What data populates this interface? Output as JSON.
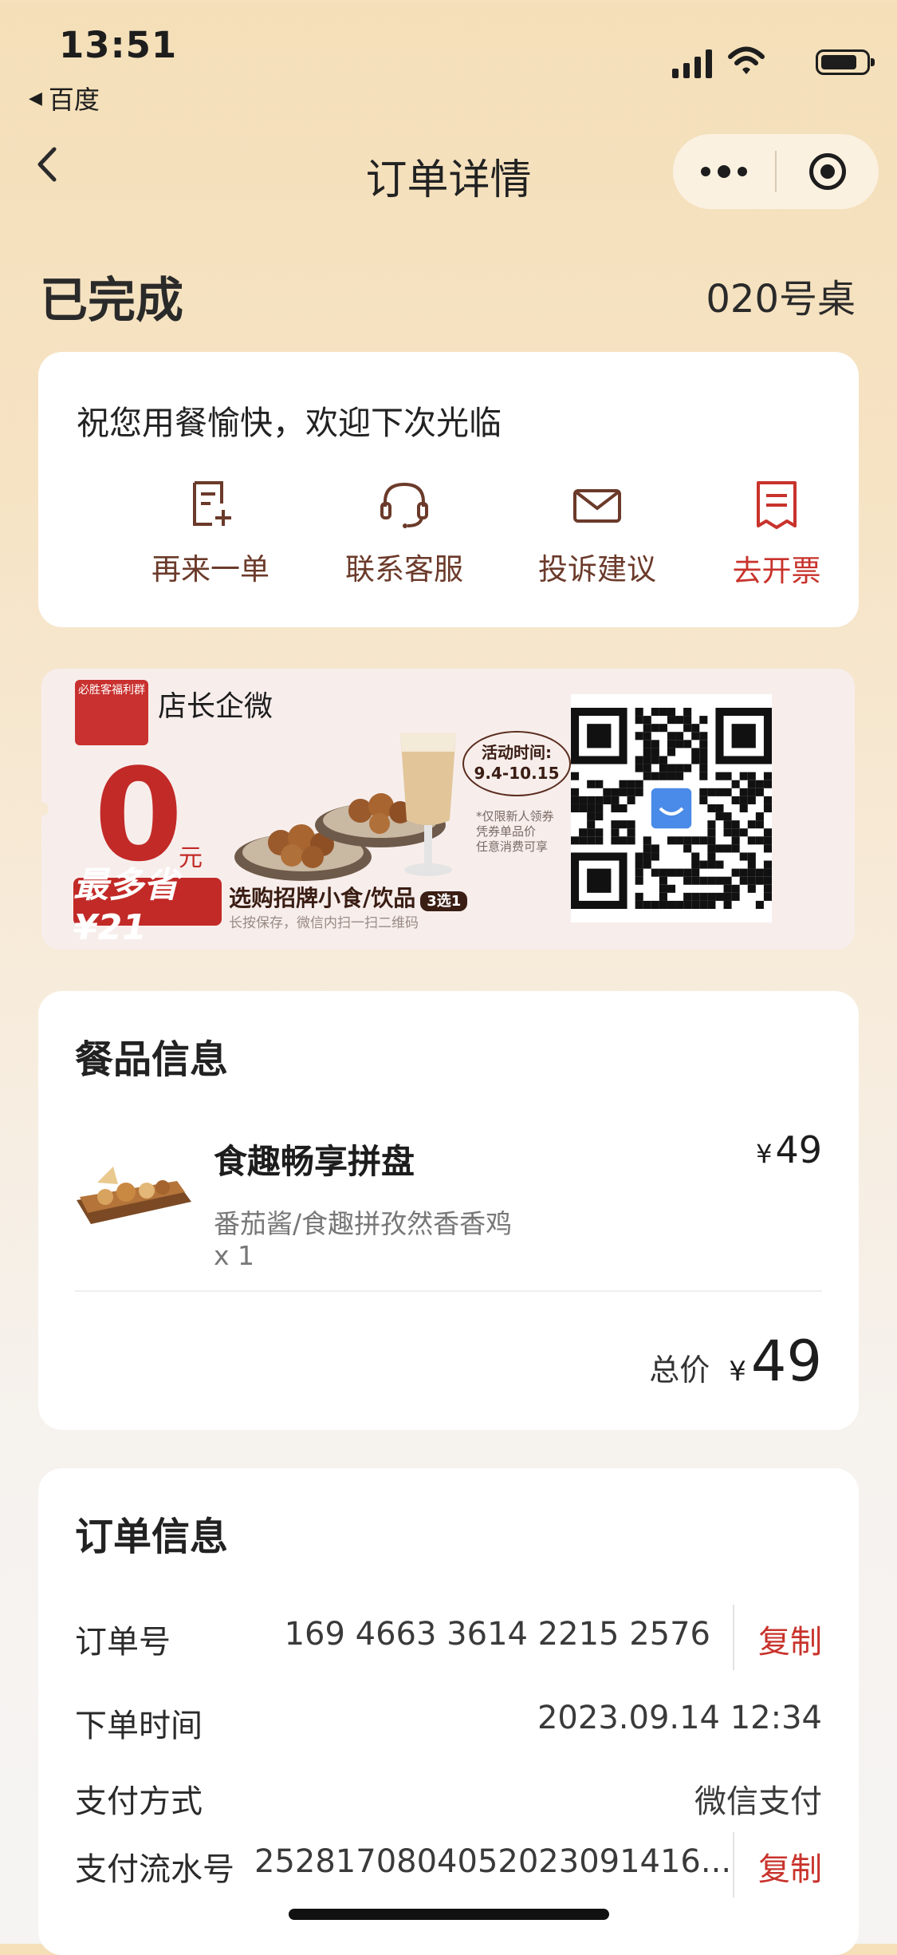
{
  "status_bar": {
    "time": "13:51",
    "back_app": "百度"
  },
  "nav": {
    "title": "订单详情"
  },
  "order": {
    "status": "已完成",
    "table": "020号桌"
  },
  "greeting": "祝您用餐愉快，欢迎下次光临",
  "actions": [
    {
      "label": "再来一单",
      "icon": "reorder-icon"
    },
    {
      "label": "联系客服",
      "icon": "headset-icon"
    },
    {
      "label": "投诉建议",
      "icon": "mail-icon"
    },
    {
      "label": "去开票",
      "icon": "invoice-icon"
    }
  ],
  "promo": {
    "tag": "必胜客福利群",
    "title": "店长企微",
    "zero": "0",
    "yuan": "元",
    "save": "最多省¥21",
    "pick": "选购招牌小食/饮品",
    "pick_badge": "3选1",
    "hint": "长按保存，微信内扫一扫二维码",
    "activity_label": "活动时间:",
    "activity_dates": "9.4-10.15",
    "fine_print": [
      "*仅限新人领券",
      "凭券单品价",
      "任意消费可享"
    ]
  },
  "items_section": {
    "heading": "餐品信息",
    "item": {
      "name": "食趣畅享拼盘",
      "spec": "番茄酱/食趣拼孜然香香鸡",
      "qty": "x 1",
      "currency": "¥",
      "price": "49"
    },
    "total_label": "总价",
    "total_currency": "¥",
    "total_value": "49"
  },
  "order_info": {
    "heading": "订单信息",
    "order_no_label": "订单号",
    "order_no": "169 4663 3614 2215 2576",
    "copy_label": "复制",
    "time_label": "下单时间",
    "time": "2023.09.14 12:34",
    "pay_method_label": "支付方式",
    "pay_method": "微信支付",
    "pay_no_label": "支付流水号",
    "pay_no": "2528170804052023091416..."
  },
  "colors": {
    "accent_red": "#c8332c",
    "brown": "#6b3a2a"
  }
}
